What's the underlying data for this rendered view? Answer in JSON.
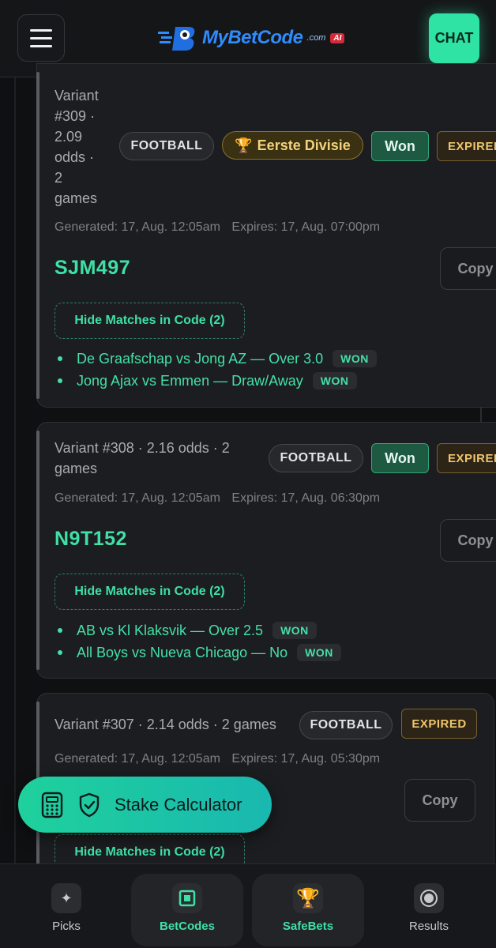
{
  "header": {
    "logo_text": "MyBetCode",
    "logo_domain": ".com",
    "logo_badge": "AI",
    "chat_label": "CHAT"
  },
  "cards": [
    {
      "variant": "Variant #309 · 2.09 odds · 2 games",
      "variant_lines": [
        "Variant",
        "#309 ·",
        "2.09",
        "odds ·",
        "2",
        "games"
      ],
      "sport": "FOOTBALL",
      "league": "Eerste Divisie",
      "result": "Won",
      "status": "EXPIRED",
      "generated": "Generated: 17, Aug. 12:05am",
      "expires": "Expires: 17, Aug. 07:00pm",
      "code": "SJM497",
      "copy_label": "Copy",
      "toggle_label": "Hide Matches in Code (2)",
      "matches": [
        {
          "text": "De Graafschap vs Jong AZ — Over 3.0",
          "tag": "WON"
        },
        {
          "text": "Jong Ajax vs Emmen — Draw/Away",
          "tag": "WON"
        }
      ]
    },
    {
      "variant_line1": "Variant #308 · 2.16 odds · 2",
      "variant_line2": "games",
      "sport": "FOOTBALL",
      "result": "Won",
      "status": "EXPIRED",
      "generated": "Generated: 17, Aug. 12:05am",
      "expires": "Expires: 17, Aug. 06:30pm",
      "code": "N9T152",
      "copy_label": "Copy",
      "toggle_label": "Hide Matches in Code (2)",
      "matches": [
        {
          "text": "AB vs Kl Klaksvik — Over 2.5",
          "tag": "WON"
        },
        {
          "text": "All Boys vs Nueva Chicago — No",
          "tag": "WON"
        }
      ]
    },
    {
      "variant": "Variant #307 · 2.14 odds · 2 games",
      "sport": "FOOTBALL",
      "status": "EXPIRED",
      "generated": "Generated: 17, Aug. 12:05am",
      "expires": "Expires: 17, Aug. 05:30pm",
      "copy_label": "Copy",
      "toggle_label": "Hide Matches in Code (2)"
    }
  ],
  "stake_calculator": {
    "label": "Stake Calculator"
  },
  "bottom_nav": [
    {
      "label": "Picks",
      "icon": "sparkle-icon"
    },
    {
      "label": "BetCodes",
      "icon": "square-icon",
      "active": true
    },
    {
      "label": "SafeBets",
      "icon": "trophy-icon"
    },
    {
      "label": "Results",
      "icon": "radio-icon"
    }
  ],
  "colors": {
    "accent": "#3ee0a6",
    "chat": "#2ee3a3",
    "won": "#1d5a41",
    "expired": "#f1c56a",
    "league": "#f3d27a"
  }
}
